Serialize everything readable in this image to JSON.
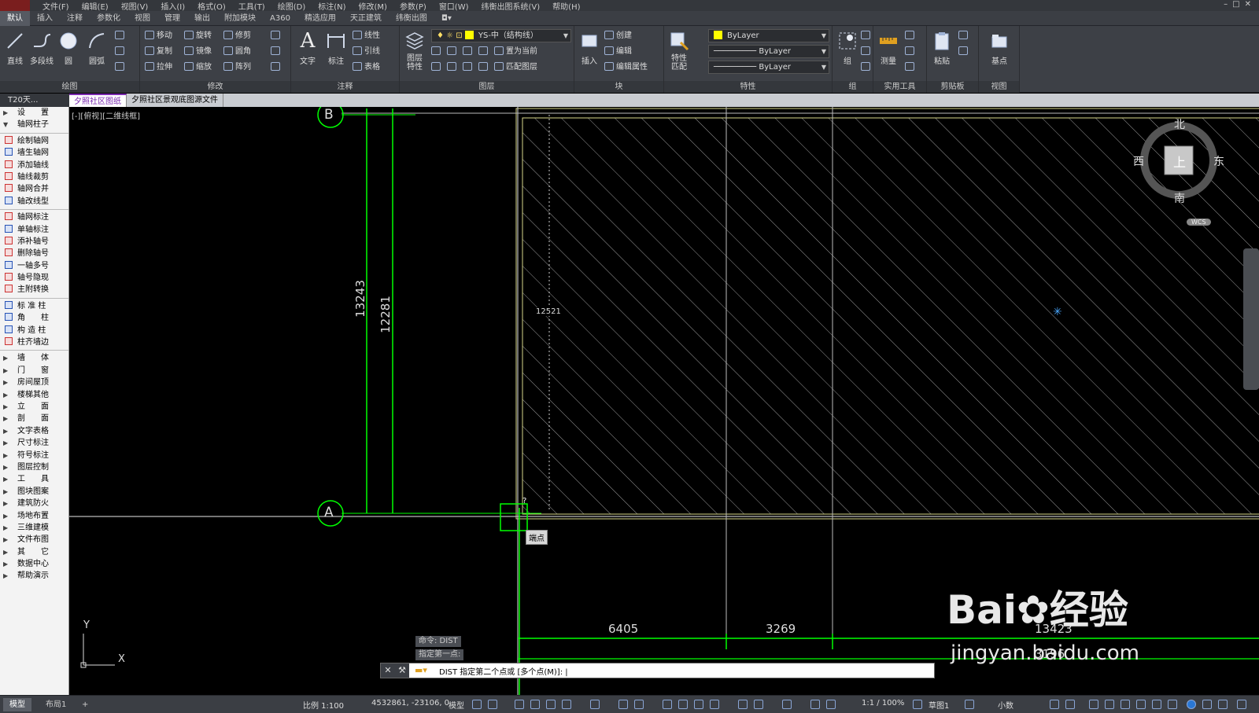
{
  "menubar": {
    "items": [
      "文件(F)",
      "编辑(E)",
      "视图(V)",
      "插入(I)",
      "格式(O)",
      "工具(T)",
      "绘图(D)",
      "标注(N)",
      "修改(M)",
      "参数(P)",
      "窗口(W)",
      "纬衡出图系统(V)",
      "帮助(H)"
    ]
  },
  "tabs": [
    "默认",
    "插入",
    "注释",
    "参数化",
    "视图",
    "管理",
    "输出",
    "附加模块",
    "A360",
    "精选应用",
    "天正建筑",
    "纬衡出图"
  ],
  "ribbon": {
    "draw": {
      "title": "绘图",
      "line": "直线",
      "polyline": "多段线",
      "circle": "圆",
      "arc": "圆弧"
    },
    "modify": {
      "title": "修改",
      "move": "移动",
      "rotate": "旋转",
      "trim": "修剪",
      "copy": "复制",
      "mirror": "镜像",
      "fillet": "圆角",
      "stretch": "拉伸",
      "scale": "缩放",
      "array": "阵列"
    },
    "annotation": {
      "title": "注释",
      "text": "文字",
      "dimension": "标注",
      "linear": "线性",
      "leader": "引线",
      "table": "表格"
    },
    "layers": {
      "title": "图层",
      "props": "图层\n特性",
      "layer_combo": "YS-中（结构线）",
      "set_current": "置为当前",
      "match_layer": "匹配图层"
    },
    "block": {
      "title": "块",
      "insert": "插入",
      "create": "创建",
      "edit": "编辑",
      "edit_attr": "编辑属性"
    },
    "properties": {
      "title": "特性",
      "match": "特性\n匹配",
      "color": "ByLayer",
      "linetype": "ByLayer",
      "lineweight": "ByLayer"
    },
    "group": {
      "title": "组",
      "group": "组"
    },
    "utilities": {
      "title": "实用工具",
      "measure": "测量"
    },
    "clipboard": {
      "title": "剪贴板",
      "paste": "粘贴"
    },
    "view": {
      "title": "视图",
      "base": "基点"
    }
  },
  "doctabs": {
    "t20": "T20天...",
    "tabs": [
      "夕照社区图纸",
      "夕照社区景观底图源文件"
    ]
  },
  "sidebar": {
    "groups": [
      {
        "label": "设　　置",
        "kind": "collapsed"
      },
      {
        "label": "轴网柱子",
        "kind": "expanded"
      }
    ],
    "axis_items": [
      "绘制轴网",
      "墙生轴网",
      "添加轴线",
      "轴线裁剪",
      "轴网合并",
      "轴改线型"
    ],
    "axis_label_items": [
      "轴网标注",
      "单轴标注",
      "添补轴号",
      "删除轴号",
      "一轴多号",
      "轴号隐现",
      "主附转换"
    ],
    "column_items": [
      "标 准 柱",
      "角　　柱",
      "构 造 柱",
      "柱齐墙边"
    ],
    "menus": [
      "墙　　体",
      "门　　窗",
      "房间屋顶",
      "楼梯其他",
      "立　　面",
      "剖　　面",
      "文字表格",
      "尺寸标注",
      "符号标注",
      "图层控制",
      "工　　具",
      "图块图案",
      "建筑防火",
      "场地布置",
      "三维建模",
      "文件布图",
      "其　　它",
      "数据中心",
      "帮助演示"
    ]
  },
  "viewport": {
    "label": "[-][俯视][二维线框]",
    "axis_b": "B",
    "axis_a": "A",
    "dim_left_1": "13243",
    "dim_left_2": "12281",
    "dim_mid": "12521",
    "dim_bottom_1": "6405",
    "dim_bottom_2": "3269",
    "dim_bottom_3": "13423",
    "dim_bottom_4": "3196",
    "snap_tooltip": "端点",
    "compass": {
      "north": "北",
      "south": "南",
      "east": "东",
      "west": "西",
      "top": "上",
      "wcs": "WCS"
    },
    "ucs_x": "X",
    "ucs_y": "Y"
  },
  "command": {
    "history_1": "命令:  DIST",
    "history_2": "指定第一点:",
    "prompt": "DIST 指定第二个点或 [多个点(M)]: |"
  },
  "watermark": {
    "brand": "Bai",
    "brand2": "经验",
    "url": "jingyan.baidu.com"
  },
  "statusbar": {
    "tab_model": "模型",
    "tab_layout": "布局1",
    "plus": "+",
    "scale": "比例 1:100",
    "coords": "4532861, -23106, 0",
    "model": "模型",
    "annoscale": "1:1 / 100%",
    "workspace": "草图1",
    "units": "小数"
  },
  "colors": {
    "accent": "#00ff00",
    "layer": "#ffff00",
    "background": "#000000",
    "ribbon": "#3d4046"
  }
}
